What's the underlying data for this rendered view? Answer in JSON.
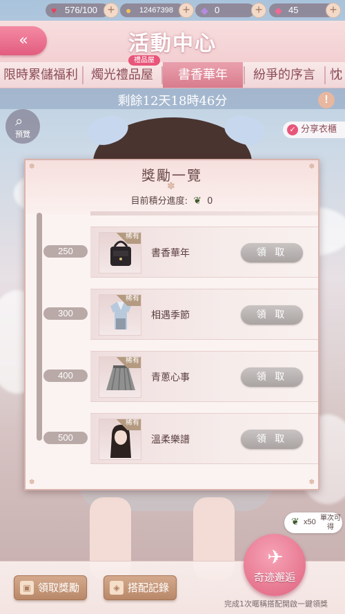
{
  "status": {
    "hearts": "576/100",
    "coins": "12467398",
    "crystals": "0",
    "diamonds": "45"
  },
  "header": {
    "back_symbol": "«",
    "title": "活動中心"
  },
  "tabs": [
    {
      "label": "限時累儲福利"
    },
    {
      "label": "燭光禮品屋",
      "badge": "禮品屋"
    },
    {
      "label": "書香華年",
      "active": true
    },
    {
      "label": "紛爭的序言"
    },
    {
      "label": "忱"
    }
  ],
  "countdown": "剩餘12天18時46分",
  "info_symbol": "!",
  "preview_label": "預覽",
  "share_label": "分享衣櫃",
  "modal": {
    "title": "獎勵一覽",
    "progress_label": "目前積分進度:",
    "progress_value": "0",
    "rewards": [
      {
        "milestone": "250",
        "name": "書香華年",
        "rarity": "稀有",
        "button": "領 取"
      },
      {
        "milestone": "300",
        "name": "相遇季節",
        "rarity": "稀有",
        "button": "領 取"
      },
      {
        "milestone": "400",
        "name": "青蔥心事",
        "rarity": "稀有",
        "button": "領 取"
      },
      {
        "milestone": "500",
        "name": "溫柔樂譜",
        "rarity": "稀有",
        "button": "領 取"
      }
    ]
  },
  "bottom": {
    "claim_rewards": "領取獎勵",
    "outfit_record": "搭配記錄",
    "miracle": "奇迹邂逅",
    "bubble_count": "x50",
    "bubble_note": "單次可得",
    "footer_note": "完成1次暱稱搭配開啟一鍵領獎"
  },
  "colors": {
    "accent_pink": "#e25d7f",
    "claim_disabled": "#a9a3a2",
    "modal_bg": "#fbf3f1"
  }
}
